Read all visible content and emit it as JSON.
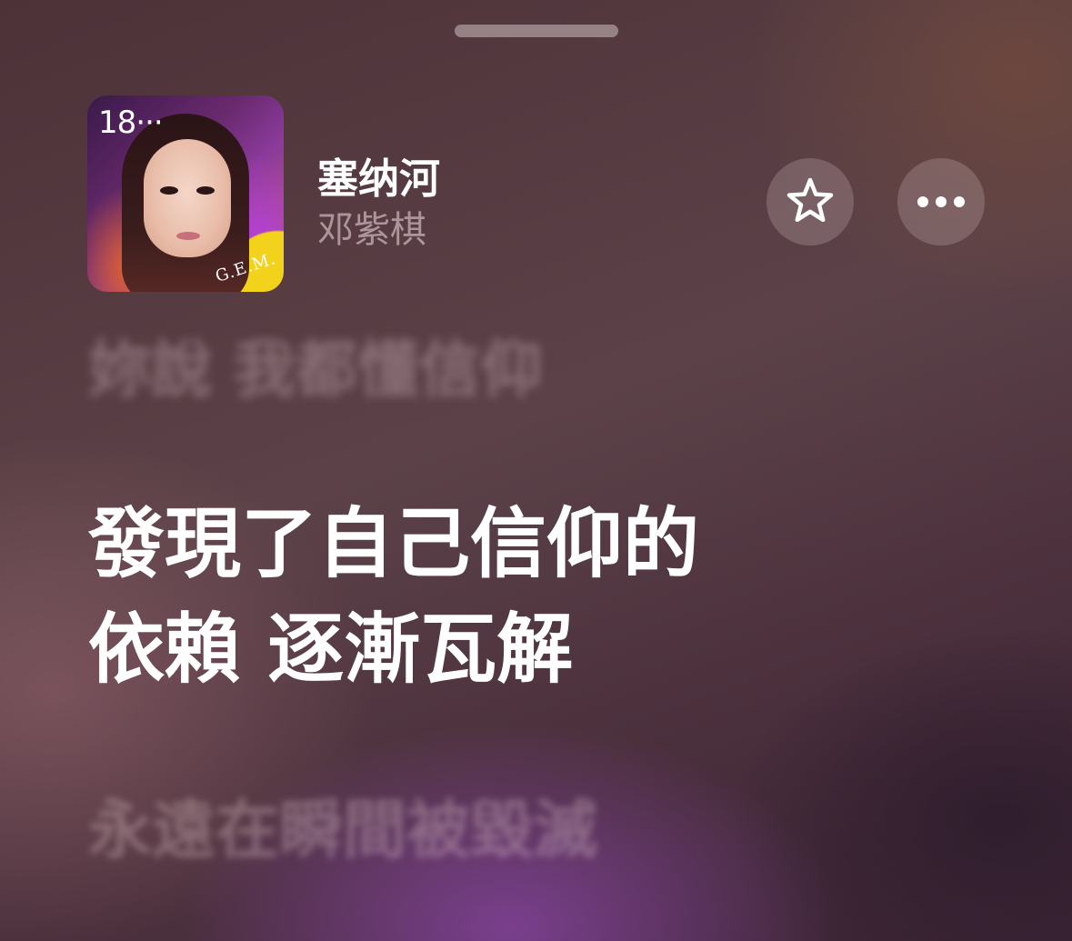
{
  "now_playing": {
    "artwork": {
      "corner_text": "18···",
      "brand_text": "G.E.M."
    },
    "title": "塞纳河",
    "artist": "邓紫棋",
    "favorite_icon": "star-icon",
    "more_icon": "ellipsis-icon"
  },
  "lyrics": {
    "previous": "妳說 我都懂信仰",
    "current": [
      "發現了自己信仰的",
      "依賴 逐漸瓦解"
    ],
    "next": "永遠在瞬間被毀滅"
  },
  "colors": {
    "text_primary": "#ffffff",
    "button_bg": "rgba(200,180,182,0.28)"
  }
}
